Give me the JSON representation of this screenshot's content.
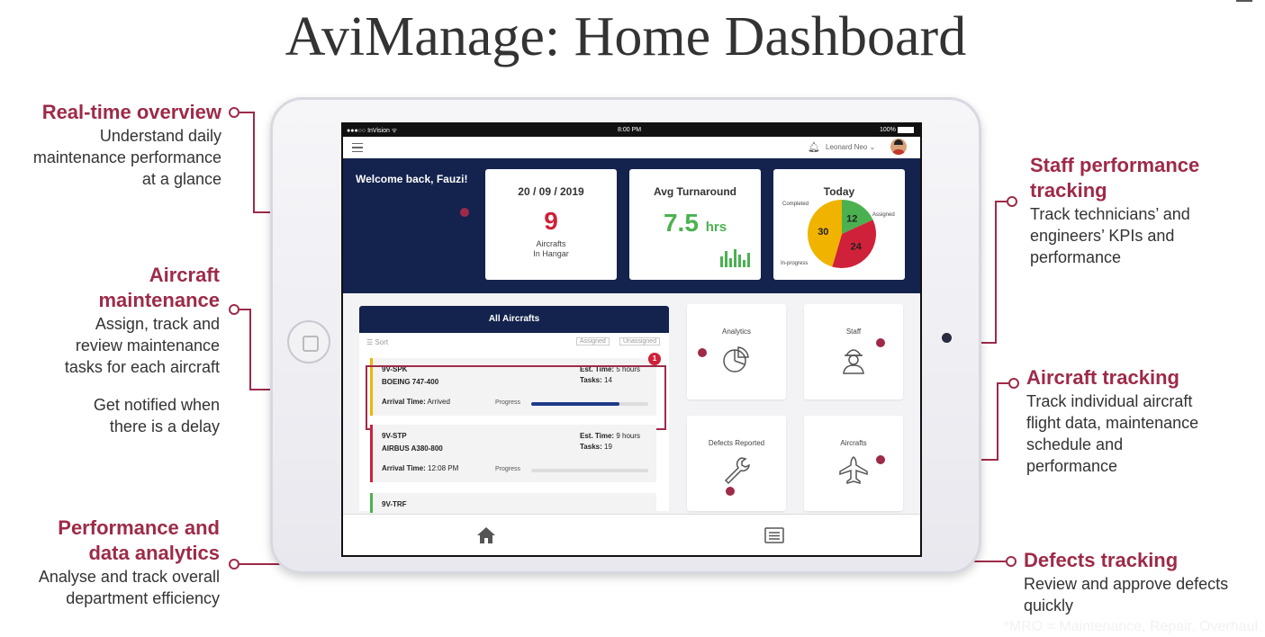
{
  "title": "AviManage: Home Dashboard",
  "footnote": "*MRO = Maintenance, Repair, Overhaul",
  "colors": {
    "accent": "#9e2a48",
    "navy": "#14234d",
    "red": "#d0213a",
    "green": "#4bb150",
    "yellow": "#f0b400"
  },
  "annotations": {
    "realtime": {
      "heading": "Real-time overview",
      "lines": [
        "Understand daily",
        "maintenance performance",
        "at a glance"
      ]
    },
    "maintenance": {
      "heading1": "Aircraft",
      "heading2": "maintenance",
      "lines": [
        "Assign, track and",
        "review maintenance",
        "tasks for each aircraft"
      ],
      "extra": [
        "Get notified when",
        "there is a delay"
      ]
    },
    "analytics": {
      "heading1": "Performance and",
      "heading2": "data analytics",
      "lines": [
        "Analyse and track overall",
        "department efficiency"
      ]
    },
    "staff": {
      "heading1": "Staff performance",
      "heading2": "tracking",
      "lines": [
        "Track technicians’ and",
        "engineers’ KPIs and",
        "performance"
      ]
    },
    "aircraft_tracking": {
      "heading": "Aircraft tracking",
      "lines": [
        "Track individual aircraft",
        "flight data, maintenance",
        "schedule and",
        "performance"
      ]
    },
    "defects": {
      "heading": "Defects tracking",
      "lines": [
        "Review and approve defects",
        "quickly"
      ]
    }
  },
  "statusbar": {
    "carrier": "●●●○○ InVision ᯤ",
    "time": "8:00 PM",
    "battery": "100%"
  },
  "appbar": {
    "user": "Leonard Neo ⌄",
    "bell_icon": "bell-icon",
    "menu_icon": "menu-icon"
  },
  "hero": {
    "welcome": "Welcome back, Fauzi!",
    "date_card": {
      "title": "20 / 09 / 2019",
      "value": "9",
      "sub1": "Aircrafts",
      "sub2": "In Hangar"
    },
    "turnaround_card": {
      "title": "Avg Turnaround",
      "value": "7.5",
      "unit": "hrs",
      "bars": [
        0.6,
        0.9,
        0.5,
        1.0,
        0.7,
        0.4,
        0.8
      ]
    },
    "today_card": {
      "title": "Today",
      "labels": {
        "completed": "Completed",
        "assigned": "Assigned",
        "inprogress": "In-progress"
      },
      "values": {
        "completed": 12,
        "assigned": 24,
        "inprogress": 30
      }
    }
  },
  "list": {
    "header": "All Aircrafts",
    "sort": "Sort",
    "tag_assigned": "Assigned",
    "tag_unassigned": "Unassigned",
    "items": [
      {
        "reg": "9V-SPK",
        "model": "BOEING 747-400",
        "est_label": "Est. Time:",
        "est": "5 hours",
        "tasks_label": "Tasks:",
        "tasks": "14",
        "arr_label": "Arrival Time:",
        "arr": "Arrived",
        "progress_label": "Progress",
        "progress": 0.75,
        "badge": "1",
        "color": "#f0b400"
      },
      {
        "reg": "9V-STP",
        "model": "AIRBUS A380-800",
        "est_label": "Est. Time:",
        "est": "9 hours",
        "tasks_label": "Tasks:",
        "tasks": "19",
        "arr_label": "Arrival Time:",
        "arr": "12:08 PM",
        "progress_label": "Progress",
        "progress": 0.0,
        "color": "#d0213a"
      },
      {
        "reg": "9V-TRF",
        "color": "#4bb150"
      }
    ]
  },
  "tiles": {
    "analytics": "Analytics",
    "staff": "Staff",
    "defects": "Defects Reported",
    "aircrafts": "Aircrafts"
  },
  "bottomnav": {
    "home_icon": "home-icon",
    "list_icon": "list-icon"
  }
}
